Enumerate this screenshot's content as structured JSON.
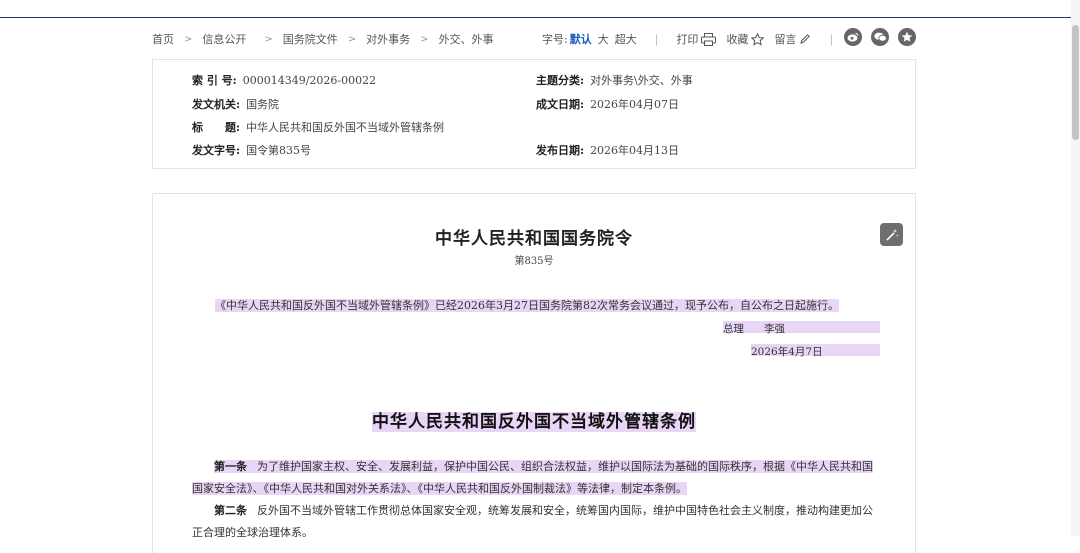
{
  "breadcrumb": {
    "items": [
      "首页",
      "信息公开",
      "国务院文件",
      "对外事务",
      "外交、外事"
    ]
  },
  "toolbar": {
    "font_size_label": "字号:",
    "font_default": "默认",
    "font_large": "大",
    "font_xlarge": "超大",
    "print": "打印",
    "favorite": "收藏",
    "comment": "留言",
    "separator": "|"
  },
  "social_icons": [
    "weibo-icon",
    "wechat-icon",
    "star-icon"
  ],
  "metadata": {
    "index_label": "索 引 号:",
    "index_value": "000014349/2026-00022",
    "category_label": "主题分类:",
    "category_value": "对外事务\\外交、外事",
    "issuer_label": "发文机关:",
    "issuer_value": "国务院",
    "date_written_label": "成文日期:",
    "date_written_value": "2026年04月07日",
    "title_label": "标　　题:",
    "title_value": "中华人民共和国反外国不当域外管辖条例",
    "doc_number_label": "发文字号:",
    "doc_number_value": "国令第835号",
    "publish_date_label": "发布日期:",
    "publish_date_value": "2026年04月13日"
  },
  "document": {
    "title": "中华人民共和国国务院令",
    "number": "第835号",
    "intro": "《中华人民共和国反外国不当域外管辖条例》已经2026年3月27日国务院第82次常务会议通过，现予公布，自公布之日起施行。",
    "signer_role": "总理",
    "signer_name": "李强",
    "sign_date": "2026年4月7日",
    "regulation_title": "中华人民共和国反外国不当域外管辖条例",
    "article1_head": "第一条",
    "article1_text": "为了维护国家主权、安全、发展利益，保护中国公民、组织合法权益，维护以国际法为基础的国际秩序，根据《中华人民共和国国家安全法》、《中华人民共和国对外关系法》、《中华人民共和国反外国制裁法》等法律，制定本条例。",
    "article2_head": "第二条",
    "article2_text": "反外国不当域外管辖工作贯彻总体国家安全观，统筹发展和安全，统筹国内国际，维护中国特色社会主义制度，推动构建更加公正合理的全球治理体系。"
  },
  "colors": {
    "accent": "#1f5fbf",
    "highlight": "#e9d5f5",
    "topline": "#1f3a5f"
  }
}
